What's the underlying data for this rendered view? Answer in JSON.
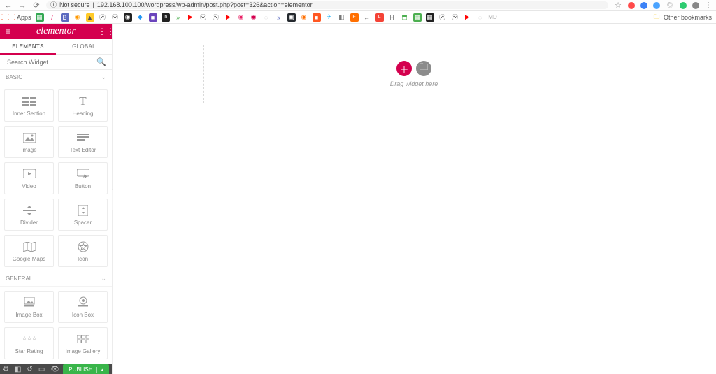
{
  "browser": {
    "url_security": "Not secure",
    "url": "192.168.100.100/wordpress/wp-admin/post.php?post=326&action=elementor",
    "other_bookmarks": "Other bookmarks",
    "apps_label": "Apps",
    "account_initials": "MD"
  },
  "header": {
    "logo": "elementor"
  },
  "tabs": {
    "elements": "ELEMENTS",
    "global": "GLOBAL"
  },
  "search": {
    "placeholder": "Search Widget..."
  },
  "categories": {
    "basic": "BASIC",
    "general": "GENERAL"
  },
  "widgets_basic": [
    {
      "label": "Inner Section"
    },
    {
      "label": "Heading"
    },
    {
      "label": "Image"
    },
    {
      "label": "Text Editor"
    },
    {
      "label": "Video"
    },
    {
      "label": "Button"
    },
    {
      "label": "Divider"
    },
    {
      "label": "Spacer"
    },
    {
      "label": "Google Maps"
    },
    {
      "label": "Icon"
    }
  ],
  "widgets_general": [
    {
      "label": "Image Box"
    },
    {
      "label": "Icon Box"
    },
    {
      "label": "Star Rating"
    },
    {
      "label": "Image Gallery"
    }
  ],
  "footer": {
    "publish": "PUBLISH"
  },
  "canvas": {
    "drop_hint": "Drag widget here"
  }
}
